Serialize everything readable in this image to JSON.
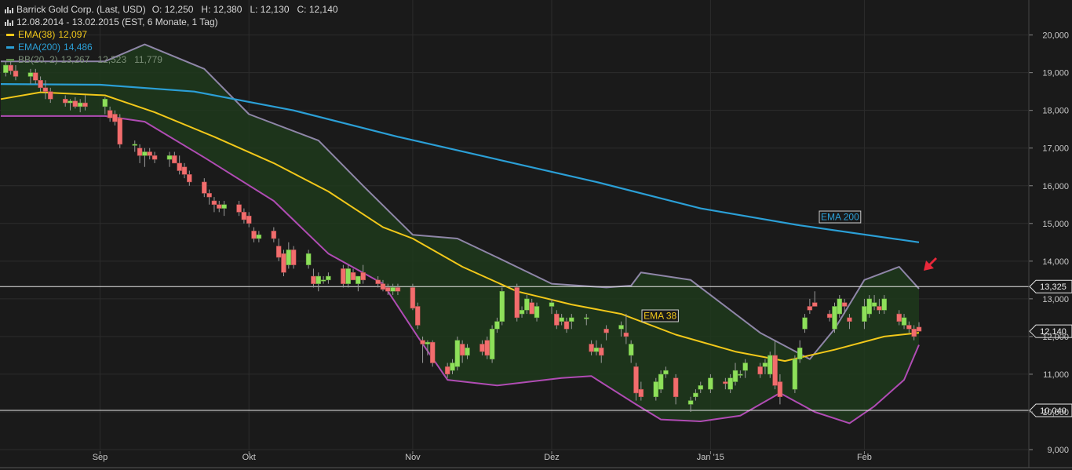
{
  "header": {
    "title": "Barrick Gold Corp. (Last, USD)",
    "ohlc": "O: 12,250   H: 12,380   L: 12,130   C: 12,140",
    "range": "12.08.2014 - 13.02.2015 (EST, 6 Monate, 1 Tag)",
    "ema38": {
      "label": "EMA(38)",
      "value": "12,097"
    },
    "ema200": {
      "label": "EMA(200)",
      "value": "14,486"
    },
    "bb": {
      "label": "BB(20, 2)",
      "values": "13,267   12,523   11,779"
    }
  },
  "colors": {
    "background": "#1a1a1a",
    "grid": "#2c2c2c",
    "up": "#8ee05a",
    "down": "#f26d6d",
    "ema38": "#f2c81a",
    "ema200": "#2b9fd6",
    "bb_upper": "#8f86a8",
    "bb_lower": "#b04cb4",
    "bb_fill": "#1f3a1c",
    "annotation_arrow": "#e8283a"
  },
  "annotations": {
    "ema200_label": "EMA 200",
    "ema38_label": "EMA 38"
  },
  "chart_data": {
    "type": "candlestick",
    "y_ticks": [
      "9,000",
      "10,000",
      "11,000",
      "12,000",
      "13,000",
      "14,000",
      "15,000",
      "16,000",
      "17,000",
      "18,000",
      "19,000",
      "20,000"
    ],
    "ylim": [
      9,
      20.2
    ],
    "x_ticks": [
      "Sep",
      "Okt",
      "Nov",
      "Dez",
      "Jan '15",
      "Feb"
    ],
    "x_tick_dates": [
      "2014-09-01",
      "2014-10-01",
      "2014-11-03",
      "2014-12-01",
      "2015-01-02",
      "2015-02-02"
    ],
    "horizontal_lines": [
      {
        "value": 13.325,
        "label": "13,325"
      },
      {
        "value": 10.04,
        "label": "10,040"
      }
    ],
    "last_price": {
      "value": 12.14,
      "label": "12,140"
    },
    "series": [
      {
        "name": "EMA(38)",
        "points": [
          [
            "2014-08-12",
            18.3
          ],
          [
            "2014-08-20",
            18.48
          ],
          [
            "2014-09-02",
            18.4
          ],
          [
            "2014-09-12",
            17.95
          ],
          [
            "2014-09-24",
            17.3
          ],
          [
            "2014-10-06",
            16.6
          ],
          [
            "2014-10-17",
            15.85
          ],
          [
            "2014-10-28",
            14.9
          ],
          [
            "2014-11-03",
            14.6
          ],
          [
            "2014-11-13",
            13.85
          ],
          [
            "2014-11-24",
            13.2
          ],
          [
            "2014-12-05",
            12.85
          ],
          [
            "2014-12-15",
            12.6
          ],
          [
            "2014-12-26",
            12.05
          ],
          [
            "2015-01-07",
            11.6
          ],
          [
            "2015-01-17",
            11.35
          ],
          [
            "2015-01-27",
            11.65
          ],
          [
            "2015-02-06",
            12.0
          ],
          [
            "2015-02-13",
            12.1
          ]
        ]
      },
      {
        "name": "EMA(200)",
        "points": [
          [
            "2014-08-12",
            18.7
          ],
          [
            "2014-09-01",
            18.68
          ],
          [
            "2014-09-20",
            18.5
          ],
          [
            "2014-10-10",
            18.0
          ],
          [
            "2014-10-31",
            17.3
          ],
          [
            "2014-11-20",
            16.7
          ],
          [
            "2014-12-10",
            16.1
          ],
          [
            "2014-12-31",
            15.4
          ],
          [
            "2015-01-20",
            14.95
          ],
          [
            "2015-02-13",
            14.5
          ]
        ]
      },
      {
        "name": "BB upper",
        "points": [
          [
            "2014-08-12",
            19.3
          ],
          [
            "2014-09-02",
            19.3
          ],
          [
            "2014-09-10",
            19.75
          ],
          [
            "2014-09-22",
            19.1
          ],
          [
            "2014-10-01",
            17.9
          ],
          [
            "2014-10-15",
            17.2
          ],
          [
            "2014-10-24",
            16.0
          ],
          [
            "2014-11-03",
            14.7
          ],
          [
            "2014-11-12",
            14.6
          ],
          [
            "2014-11-20",
            14.1
          ],
          [
            "2014-12-01",
            13.4
          ],
          [
            "2014-12-12",
            13.3
          ],
          [
            "2014-12-17",
            13.35
          ],
          [
            "2014-12-19",
            13.7
          ],
          [
            "2014-12-29",
            13.5
          ],
          [
            "2015-01-12",
            12.1
          ],
          [
            "2015-01-22",
            11.4
          ],
          [
            "2015-01-27",
            12.2
          ],
          [
            "2015-02-02",
            13.5
          ],
          [
            "2015-02-09",
            13.85
          ],
          [
            "2015-02-13",
            13.27
          ]
        ]
      },
      {
        "name": "BB lower",
        "points": [
          [
            "2014-08-12",
            17.85
          ],
          [
            "2014-09-02",
            17.85
          ],
          [
            "2014-09-10",
            17.7
          ],
          [
            "2014-09-22",
            16.75
          ],
          [
            "2014-10-06",
            15.6
          ],
          [
            "2014-10-17",
            14.2
          ],
          [
            "2014-10-28",
            13.4
          ],
          [
            "2014-11-04",
            12.0
          ],
          [
            "2014-11-10",
            10.85
          ],
          [
            "2014-11-20",
            10.7
          ],
          [
            "2014-12-03",
            10.9
          ],
          [
            "2014-12-09",
            10.95
          ],
          [
            "2014-12-18",
            10.2
          ],
          [
            "2014-12-23",
            9.8
          ],
          [
            "2014-12-31",
            9.75
          ],
          [
            "2015-01-08",
            9.9
          ],
          [
            "2015-01-16",
            10.5
          ],
          [
            "2015-01-23",
            10.0
          ],
          [
            "2015-01-30",
            9.7
          ],
          [
            "2015-02-04",
            10.15
          ],
          [
            "2015-02-10",
            10.85
          ],
          [
            "2015-02-13",
            11.78
          ]
        ]
      }
    ],
    "candles": [
      [
        "2014-08-13",
        19.0,
        19.3,
        18.9,
        19.2
      ],
      [
        "2014-08-14",
        19.2,
        19.35,
        18.95,
        19.05
      ],
      [
        "2014-08-15",
        19.05,
        19.2,
        18.8,
        18.9
      ],
      [
        "2014-08-18",
        18.9,
        19.1,
        18.7,
        19.0
      ],
      [
        "2014-08-19",
        19.0,
        19.1,
        18.7,
        18.8
      ],
      [
        "2014-08-20",
        18.8,
        18.9,
        18.5,
        18.6
      ],
      [
        "2014-08-21",
        18.6,
        18.8,
        18.3,
        18.5
      ],
      [
        "2014-08-22",
        18.5,
        18.6,
        18.2,
        18.3
      ],
      [
        "2014-08-25",
        18.3,
        18.4,
        18.1,
        18.2
      ],
      [
        "2014-08-26",
        18.2,
        18.3,
        18.0,
        18.25
      ],
      [
        "2014-08-27",
        18.25,
        18.35,
        18.05,
        18.1
      ],
      [
        "2014-08-28",
        18.1,
        18.3,
        17.95,
        18.2
      ],
      [
        "2014-08-29",
        18.2,
        18.4,
        18.0,
        18.1
      ],
      [
        "2014-09-02",
        18.1,
        18.35,
        17.9,
        18.3
      ],
      [
        "2014-09-03",
        18.0,
        18.1,
        17.7,
        17.8
      ],
      [
        "2014-09-04",
        17.9,
        18.0,
        17.6,
        17.7
      ],
      [
        "2014-09-05",
        17.8,
        17.9,
        17.0,
        17.1
      ],
      [
        "2014-09-08",
        17.1,
        17.2,
        16.9,
        17.1
      ],
      [
        "2014-09-09",
        17.0,
        17.1,
        16.6,
        16.8
      ],
      [
        "2014-09-10",
        16.8,
        17.0,
        16.5,
        16.9
      ],
      [
        "2014-09-11",
        16.9,
        17.0,
        16.7,
        16.8
      ],
      [
        "2014-09-12",
        16.8,
        16.9,
        16.6,
        16.7
      ],
      [
        "2014-09-15",
        16.7,
        16.9,
        16.5,
        16.8
      ],
      [
        "2014-09-16",
        16.8,
        16.9,
        16.6,
        16.6
      ],
      [
        "2014-09-17",
        16.6,
        16.8,
        16.3,
        16.4
      ],
      [
        "2014-09-18",
        16.5,
        16.6,
        16.2,
        16.3
      ],
      [
        "2014-09-19",
        16.3,
        16.4,
        16.0,
        16.1
      ],
      [
        "2014-09-22",
        16.1,
        16.2,
        15.7,
        15.8
      ],
      [
        "2014-09-23",
        15.8,
        15.9,
        15.5,
        15.7
      ],
      [
        "2014-09-24",
        15.6,
        15.7,
        15.3,
        15.5
      ],
      [
        "2014-09-25",
        15.5,
        15.6,
        15.3,
        15.4
      ],
      [
        "2014-09-26",
        15.4,
        15.6,
        15.2,
        15.5
      ],
      [
        "2014-09-29",
        15.5,
        15.6,
        15.2,
        15.3
      ],
      [
        "2014-09-30",
        15.3,
        15.4,
        15.0,
        15.1
      ],
      [
        "2014-10-01",
        15.2,
        15.3,
        14.9,
        15.0
      ],
      [
        "2014-10-02",
        14.8,
        14.9,
        14.5,
        14.6
      ],
      [
        "2014-10-03",
        14.6,
        14.8,
        14.5,
        14.7
      ],
      [
        "2014-10-06",
        14.8,
        14.9,
        14.5,
        14.6
      ],
      [
        "2014-10-07",
        14.4,
        14.6,
        14.0,
        14.1
      ],
      [
        "2014-10-08",
        14.2,
        14.3,
        13.6,
        13.7
      ],
      [
        "2014-10-09",
        13.9,
        14.5,
        13.8,
        14.3
      ],
      [
        "2014-10-10",
        14.3,
        14.4,
        13.8,
        13.9
      ],
      [
        "2014-10-13",
        13.9,
        14.3,
        13.8,
        14.2
      ],
      [
        "2014-10-14",
        13.6,
        13.8,
        13.3,
        13.4
      ],
      [
        "2014-10-15",
        13.4,
        13.7,
        13.2,
        13.6
      ],
      [
        "2014-10-16",
        13.5,
        13.6,
        13.4,
        13.5
      ],
      [
        "2014-10-17",
        13.5,
        13.7,
        13.4,
        13.6
      ],
      [
        "2014-10-20",
        13.8,
        13.9,
        13.3,
        13.4
      ],
      [
        "2014-10-21",
        13.4,
        13.9,
        13.3,
        13.8
      ],
      [
        "2014-10-22",
        13.7,
        13.8,
        13.5,
        13.5
      ],
      [
        "2014-10-23",
        13.4,
        13.6,
        13.2,
        13.6
      ],
      [
        "2014-10-24",
        13.7,
        13.9,
        13.4,
        13.5
      ],
      [
        "2014-10-27",
        13.5,
        13.6,
        13.3,
        13.4
      ],
      [
        "2014-10-28",
        13.4,
        13.5,
        13.2,
        13.25
      ],
      [
        "2014-10-29",
        13.3,
        13.4,
        13.1,
        13.2
      ],
      [
        "2014-10-30",
        13.2,
        13.4,
        13.1,
        13.3
      ],
      [
        "2014-10-31",
        13.3,
        13.4,
        13.1,
        13.2
      ],
      [
        "2014-11-03",
        13.3,
        13.4,
        12.7,
        12.75
      ],
      [
        "2014-11-04",
        12.8,
        12.9,
        12.2,
        12.3
      ],
      [
        "2014-11-05",
        11.9,
        12.0,
        11.3,
        11.8
      ],
      [
        "2014-11-06",
        11.8,
        11.9,
        11.5,
        11.85
      ],
      [
        "2014-11-07",
        11.85,
        11.9,
        11.2,
        11.3
      ],
      [
        "2014-11-10",
        11.2,
        11.3,
        10.9,
        11.0
      ],
      [
        "2014-11-11",
        11.1,
        11.4,
        11.0,
        11.3
      ],
      [
        "2014-11-12",
        11.2,
        12.0,
        11.1,
        11.9
      ],
      [
        "2014-11-13",
        11.8,
        11.9,
        11.3,
        11.5
      ],
      [
        "2014-11-14",
        11.5,
        11.8,
        11.4,
        11.7
      ],
      [
        "2014-11-17",
        11.8,
        11.9,
        11.5,
        11.6
      ],
      [
        "2014-11-18",
        11.9,
        12.0,
        11.4,
        11.5
      ],
      [
        "2014-11-19",
        11.4,
        12.3,
        11.3,
        12.2
      ],
      [
        "2014-11-20",
        12.2,
        12.5,
        12.1,
        12.4
      ],
      [
        "2014-11-21",
        12.4,
        13.3,
        12.3,
        13.2
      ],
      [
        "2014-11-24",
        13.3,
        13.4,
        12.4,
        12.5
      ],
      [
        "2014-11-25",
        12.6,
        12.8,
        12.5,
        12.7
      ],
      [
        "2014-11-26",
        12.7,
        13.1,
        12.6,
        13.0
      ],
      [
        "2014-11-27",
        12.9,
        13.0,
        12.7,
        12.6
      ],
      [
        "2014-11-28",
        12.5,
        12.9,
        12.4,
        12.8
      ],
      [
        "2014-12-01",
        12.8,
        13.0,
        12.6,
        12.9
      ],
      [
        "2014-12-02",
        12.6,
        12.7,
        12.2,
        12.3
      ],
      [
        "2014-12-03",
        12.4,
        12.6,
        12.3,
        12.5
      ],
      [
        "2014-12-04",
        12.4,
        12.5,
        12.1,
        12.2
      ],
      [
        "2014-12-05",
        12.4,
        12.6,
        12.2,
        12.5
      ],
      [
        "2014-12-08",
        12.5,
        12.6,
        12.3,
        12.5
      ],
      [
        "2014-12-09",
        11.8,
        11.9,
        11.5,
        11.6
      ],
      [
        "2014-12-10",
        11.6,
        11.9,
        11.5,
        11.7
      ],
      [
        "2014-12-11",
        11.7,
        11.8,
        11.3,
        11.5
      ],
      [
        "2014-12-12",
        12.2,
        12.3,
        11.9,
        12.1
      ],
      [
        "2014-12-15",
        12.2,
        12.4,
        12.0,
        12.3
      ],
      [
        "2014-12-16",
        12.1,
        12.6,
        11.8,
        12.0
      ],
      [
        "2014-12-17",
        11.5,
        11.9,
        11.3,
        11.8
      ],
      [
        "2014-12-18",
        11.2,
        11.3,
        10.3,
        10.5
      ],
      [
        "2014-12-19",
        10.6,
        10.8,
        10.3,
        10.4
      ],
      [
        "2014-12-22",
        10.4,
        10.9,
        10.3,
        10.8
      ],
      [
        "2014-12-23",
        10.6,
        11.1,
        10.5,
        11.0
      ],
      [
        "2014-12-24",
        11.0,
        11.2,
        10.9,
        11.1
      ],
      [
        "2014-12-26",
        10.9,
        11.0,
        10.2,
        10.4
      ],
      [
        "2014-12-29",
        10.2,
        10.4,
        10.0,
        10.3
      ],
      [
        "2014-12-30",
        10.4,
        10.6,
        10.3,
        10.5
      ],
      [
        "2014-12-31",
        10.6,
        10.8,
        10.5,
        10.7
      ],
      [
        "2015-01-02",
        10.6,
        11.0,
        10.5,
        10.9
      ],
      [
        "2015-01-05",
        10.8,
        10.9,
        10.6,
        10.75
      ],
      [
        "2015-01-06",
        10.6,
        11.0,
        10.5,
        10.9
      ],
      [
        "2015-01-07",
        10.8,
        11.3,
        10.7,
        11.1
      ],
      [
        "2015-01-08",
        11.0,
        11.1,
        10.9,
        11.0
      ],
      [
        "2015-01-09",
        11.1,
        11.4,
        10.9,
        11.3
      ],
      [
        "2015-01-12",
        11.2,
        11.3,
        10.9,
        11.0
      ],
      [
        "2015-01-13",
        11.2,
        11.4,
        11.0,
        11.3
      ],
      [
        "2015-01-14",
        11.0,
        11.6,
        10.9,
        11.5
      ],
      [
        "2015-01-15",
        11.5,
        11.9,
        10.6,
        10.7
      ],
      [
        "2015-01-16",
        10.8,
        11.0,
        10.2,
        10.4
      ],
      [
        "2015-01-19",
        10.6,
        11.5,
        10.5,
        11.4
      ],
      [
        "2015-01-20",
        11.4,
        11.9,
        11.3,
        11.7
      ],
      [
        "2015-01-21",
        12.2,
        12.6,
        12.1,
        12.5
      ],
      [
        "2015-01-22",
        12.8,
        13.0,
        12.6,
        12.7
      ],
      [
        "2015-01-23",
        12.9,
        13.2,
        12.8,
        12.8
      ],
      [
        "2015-01-26",
        12.6,
        12.7,
        12.4,
        12.5
      ],
      [
        "2015-01-27",
        12.2,
        12.9,
        12.1,
        12.8
      ],
      [
        "2015-01-28",
        12.6,
        13.1,
        12.5,
        13.0
      ],
      [
        "2015-01-29",
        12.9,
        13.0,
        12.6,
        12.8
      ],
      [
        "2015-01-30",
        12.5,
        12.6,
        12.2,
        12.4
      ],
      [
        "2015-02-02",
        12.4,
        13.0,
        12.2,
        12.8
      ],
      [
        "2015-02-03",
        12.6,
        13.1,
        12.5,
        13.0
      ],
      [
        "2015-02-04",
        12.8,
        13.1,
        12.7,
        12.9
      ],
      [
        "2015-02-05",
        12.8,
        13.0,
        12.6,
        12.7
      ],
      [
        "2015-02-06",
        12.7,
        13.1,
        12.6,
        13.0
      ],
      [
        "2015-02-09",
        12.6,
        12.7,
        12.3,
        12.4
      ],
      [
        "2015-02-10",
        12.3,
        12.6,
        12.2,
        12.5
      ],
      [
        "2015-02-11",
        12.3,
        12.4,
        12.1,
        12.2
      ],
      [
        "2015-02-12",
        12.2,
        12.3,
        11.9,
        12.0
      ],
      [
        "2015-02-13",
        12.25,
        12.38,
        12.13,
        12.14
      ]
    ]
  }
}
